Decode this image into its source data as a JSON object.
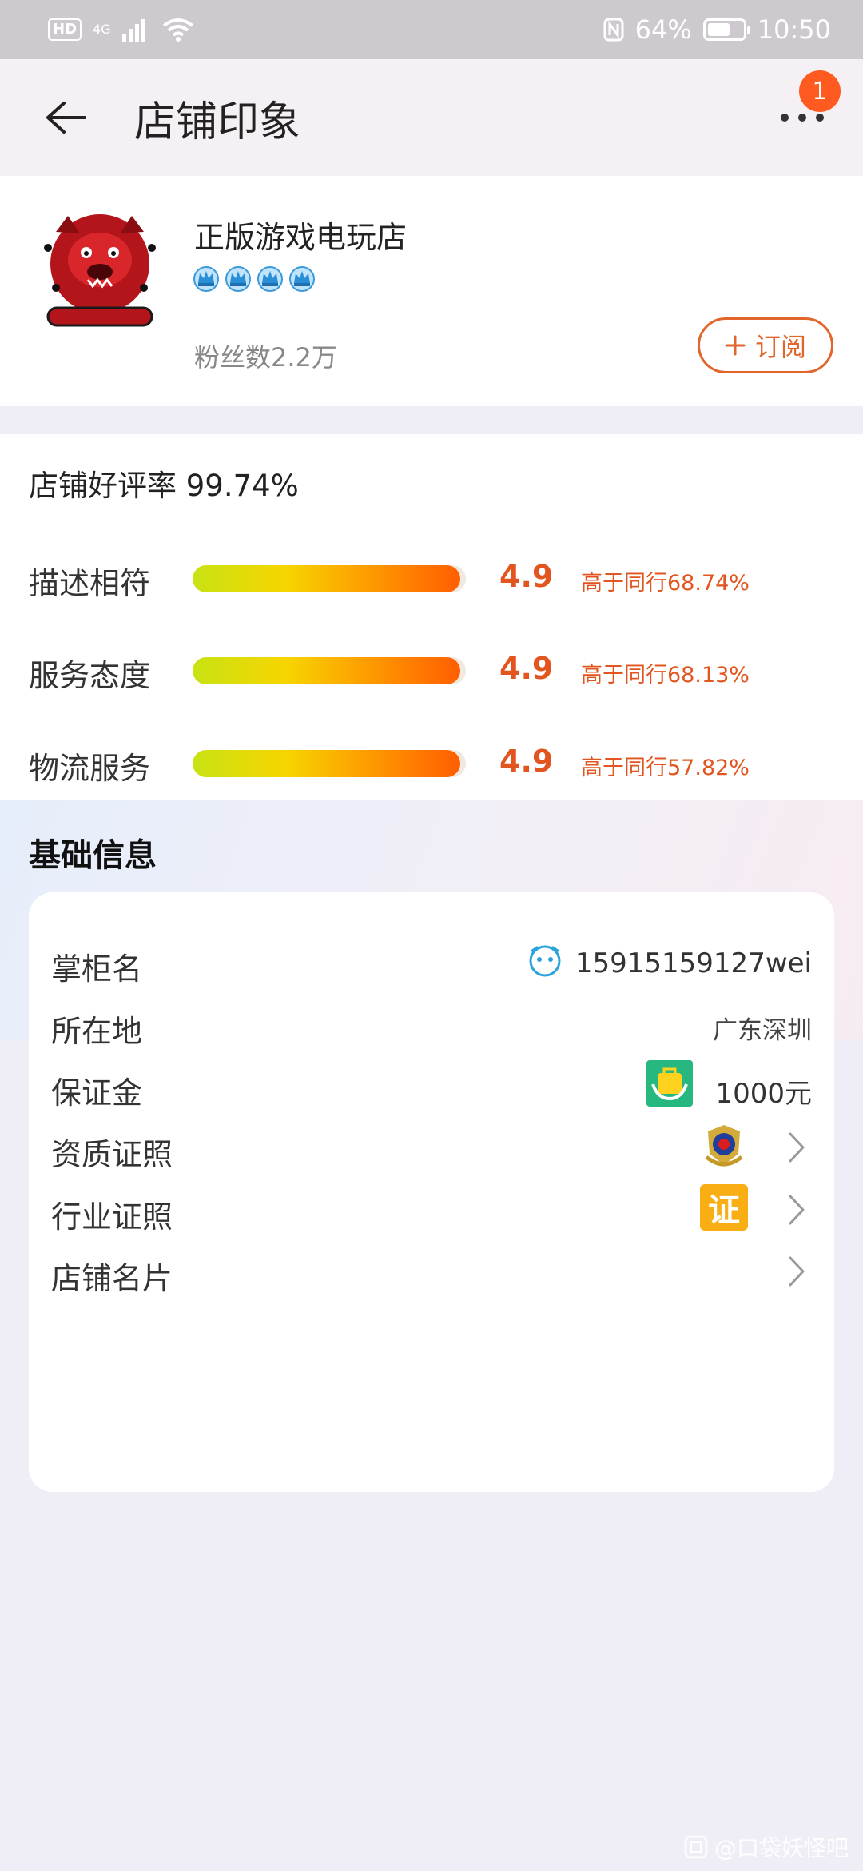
{
  "status_bar": {
    "hd": "HD",
    "network": "4G",
    "battery_percent_text": "64%",
    "battery_level": 0.64,
    "time": "10:50"
  },
  "header": {
    "title": "店铺印象",
    "notification_count": "1"
  },
  "shop": {
    "name": "正版游戏电玩店",
    "crown_count": 4,
    "fans": "粉丝数2.2万",
    "subscribe_label": "订阅"
  },
  "rating": {
    "title": "店铺好评率 99.74%",
    "rows": [
      {
        "label": "描述相符",
        "score": "4.9",
        "compare": "高于同行68.74%",
        "level": 0.98
      },
      {
        "label": "服务态度",
        "score": "4.9",
        "compare": "高于同行68.13%",
        "level": 0.98
      },
      {
        "label": "物流服务",
        "score": "4.9",
        "compare": "高于同行57.82%",
        "level": 0.98
      }
    ]
  },
  "basic": {
    "title": "基础信息",
    "rows": [
      {
        "label": "掌柜名",
        "value": "15915159127wei",
        "icon": "wangwang-icon"
      },
      {
        "label": "所在地",
        "value": "广东深圳"
      },
      {
        "label": "保证金",
        "value": "1000元",
        "icon": "deposit-bag-icon"
      },
      {
        "label": "资质证照",
        "icon": "police-badge-icon"
      },
      {
        "label": "行业证照",
        "icon": "certificate-icon",
        "icon_text": "证"
      },
      {
        "label": "店铺名片"
      }
    ]
  },
  "watermark": "@口袋妖怪吧",
  "colors": {
    "accent": "#e2551f",
    "subscribe": "#e2662c",
    "badge": "#ff5a1f"
  }
}
